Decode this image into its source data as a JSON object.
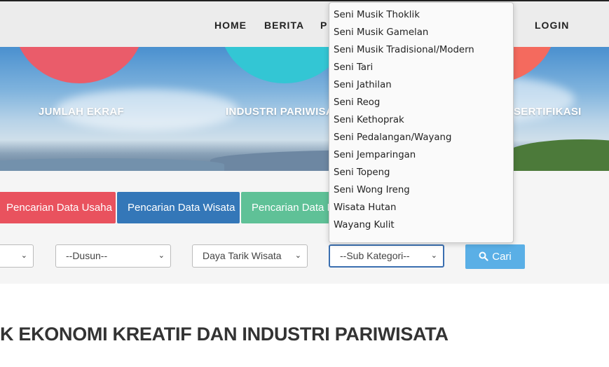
{
  "nav": {
    "home": "HOME",
    "berita": "BERITA",
    "partial": "P",
    "login": "LOGIN"
  },
  "hero": {
    "stats": [
      {
        "label": "JUMLAH EKRAF"
      },
      {
        "label": "INDUSTRI PARIWISA"
      },
      {
        "label": "SERTIFIKASI"
      }
    ],
    "circle_colors": [
      "#ea5c6a",
      "#33c6d4",
      "#f46a5e"
    ]
  },
  "tabs": [
    {
      "label": "Pencarian Data Usaha",
      "color": "#e9525e"
    },
    {
      "label": "Pencarian Data Wisata",
      "color": "#3477b8"
    },
    {
      "label": "Pencarian Data Ev",
      "color": "#5fc197"
    }
  ],
  "filters": {
    "dusun": "--Dusun--",
    "daya_tarik": "Daya Tarik Wisata",
    "sub_kategori": "--Sub Kategori--",
    "cari": "Cari"
  },
  "dropdown": {
    "items": [
      "Seni Musik Thoklik",
      "Seni Musik Gamelan",
      "Seni Musik Tradisional/Modern",
      "Seni Tari",
      "Seni Jathilan",
      "Seni Reog",
      "Seni Kethoprak",
      "Seni Pedalangan/Wayang",
      "Seni Jemparingan",
      "Seni Topeng",
      "Seni Wong Ireng",
      "Wisata Hutan",
      "Wayang Kulit"
    ]
  },
  "section_title": "K EKONOMI KREATIF DAN INDUSTRI PARIWISATA"
}
